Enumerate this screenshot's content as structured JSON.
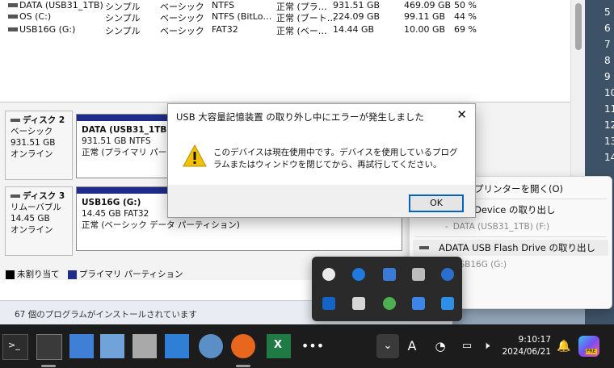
{
  "volumes": [
    {
      "name": "DATA (USB31_1TB)",
      "layout": "シンプル",
      "type": "ベーシック",
      "fs": "NTFS",
      "status": "正常 (プラ…",
      "capacity": "931.51 GB",
      "free": "469.09 GB",
      "pct": "50 %"
    },
    {
      "name": "OS (C:)",
      "layout": "シンプル",
      "type": "ベーシック",
      "fs": "NTFS (BitLo…",
      "status": "正常 (ブート…",
      "capacity": "224.09 GB",
      "free": "99.11 GB",
      "pct": "44 %"
    },
    {
      "name": "USB16G (G:)",
      "layout": "シンプル",
      "type": "ベーシック",
      "fs": "FAT32",
      "status": "正常 (ベー…",
      "capacity": "14.44 GB",
      "free": "10.00 GB",
      "pct": "69 %"
    }
  ],
  "disks": [
    {
      "name": "ディスク 2",
      "type": "ベーシック",
      "size": "931.51 GB",
      "state": "オンライン",
      "partition": {
        "title": "DATA (USB31_1TB) (F",
        "size": "931.51 GB NTFS",
        "status": "正常 (プライマリ パーティ"
      }
    },
    {
      "name": "ディスク 3",
      "type": "リムーバブル",
      "size": "14.45 GB",
      "state": "オンライン",
      "partition": {
        "title": "USB16G  (G:)",
        "size": "14.45 GB FAT32",
        "status": "正常 (ベーシック データ パーティション)"
      }
    }
  ],
  "legend": {
    "unallocated": "未割り当て",
    "primary": "プライマリ パーティション"
  },
  "status_bar": "67 個のプログラムがインストールされています",
  "right_numbers": [
    "5",
    "6",
    "7",
    "8",
    "9",
    "10",
    "11",
    "12",
    "13",
    "14"
  ],
  "dialog": {
    "title": "USB 大容量記憶装置 の取り外し中にエラーが発生しました",
    "message": "このデバイスは現在使用中です。デバイスを使用しているプログラムまたはウィンドウを閉じてから、再試行してください。",
    "ok": "OK"
  },
  "eject_menu": {
    "items": [
      {
        "label": "プリンターを開く(O)"
      },
      {
        "label": "Device の取り出し"
      },
      {
        "label": "DATA (USB31_1TB) (F:)",
        "sub": true
      },
      {
        "label": "ADATA USB Flash Drive の取り出し",
        "highlighted": true
      },
      {
        "label": "USB16G (G:)",
        "sub": true
      }
    ]
  },
  "clock": {
    "time": "9:10:17",
    "date": "2024/06/21"
  },
  "colors": {
    "partition_bar": "#1f2c8a",
    "taskbar": "#1c1c1c",
    "accent": "#0063c0",
    "warning": "#f2c200"
  }
}
